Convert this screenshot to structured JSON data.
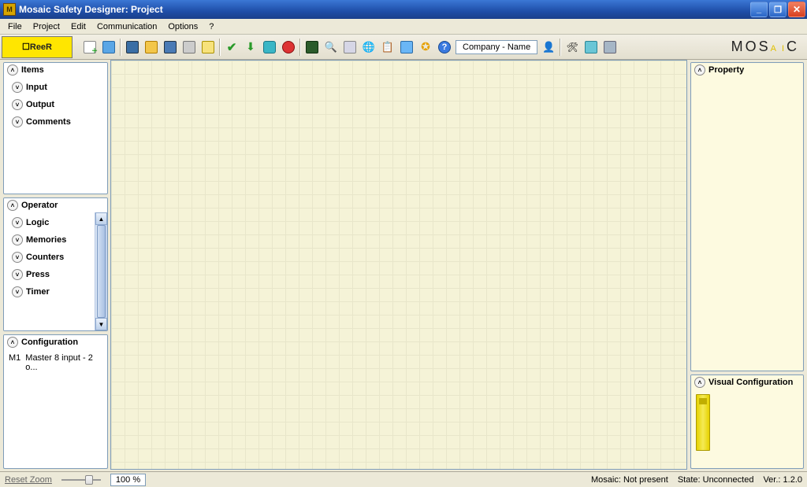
{
  "title": "Mosaic Safety Designer: Project",
  "menu": {
    "file": "File",
    "project": "Project",
    "edit": "Edit",
    "communication": "Communication",
    "options": "Options",
    "help": "?"
  },
  "brand_left": "ReeR",
  "brand_right_text": "MOSAIC",
  "toolbar": {
    "company_label": "Company - Name",
    "icons": {
      "new": "new-doc-icon",
      "folder_info": "folder-info-icon",
      "save": "save-icon",
      "open": "open-folder-icon",
      "saveas": "save-disk-icon",
      "print": "print-icon",
      "edit": "pencil-icon",
      "validate": "checkmark-icon",
      "download": "download-icon",
      "connect": "connect-icon",
      "disconnect": "record-icon",
      "monitor1": "chip-icon",
      "zoom": "magnifier-icon",
      "monitor2": "monitor-icon",
      "globe": "globe-icon",
      "paste": "clipboard-icon",
      "screen": "screen-icon",
      "star": "star-icon",
      "help": "help-icon",
      "profile": "profile-icon",
      "tools": "tools-icon",
      "module": "module-icon",
      "config": "config-icon"
    }
  },
  "left": {
    "items": {
      "title": "Items",
      "children": {
        "input": "Input",
        "output": "Output",
        "comments": "Comments"
      }
    },
    "operator": {
      "title": "Operator",
      "children": {
        "logic": "Logic",
        "memories": "Memories",
        "counters": "Counters",
        "press": "Press",
        "timer": "Timer"
      }
    },
    "config": {
      "title": "Configuration",
      "rows": [
        {
          "slot": "M1",
          "desc": "Master 8 input - 2 o..."
        }
      ]
    }
  },
  "right": {
    "property": {
      "title": "Property"
    },
    "visual": {
      "title": "Visual Configuration"
    }
  },
  "status": {
    "reset": "Reset Zoom",
    "zoom_value": "100 %",
    "mosaic": "Mosaic: Not present",
    "state": "State: Unconnected",
    "version": "Ver.: 1.2.0"
  }
}
